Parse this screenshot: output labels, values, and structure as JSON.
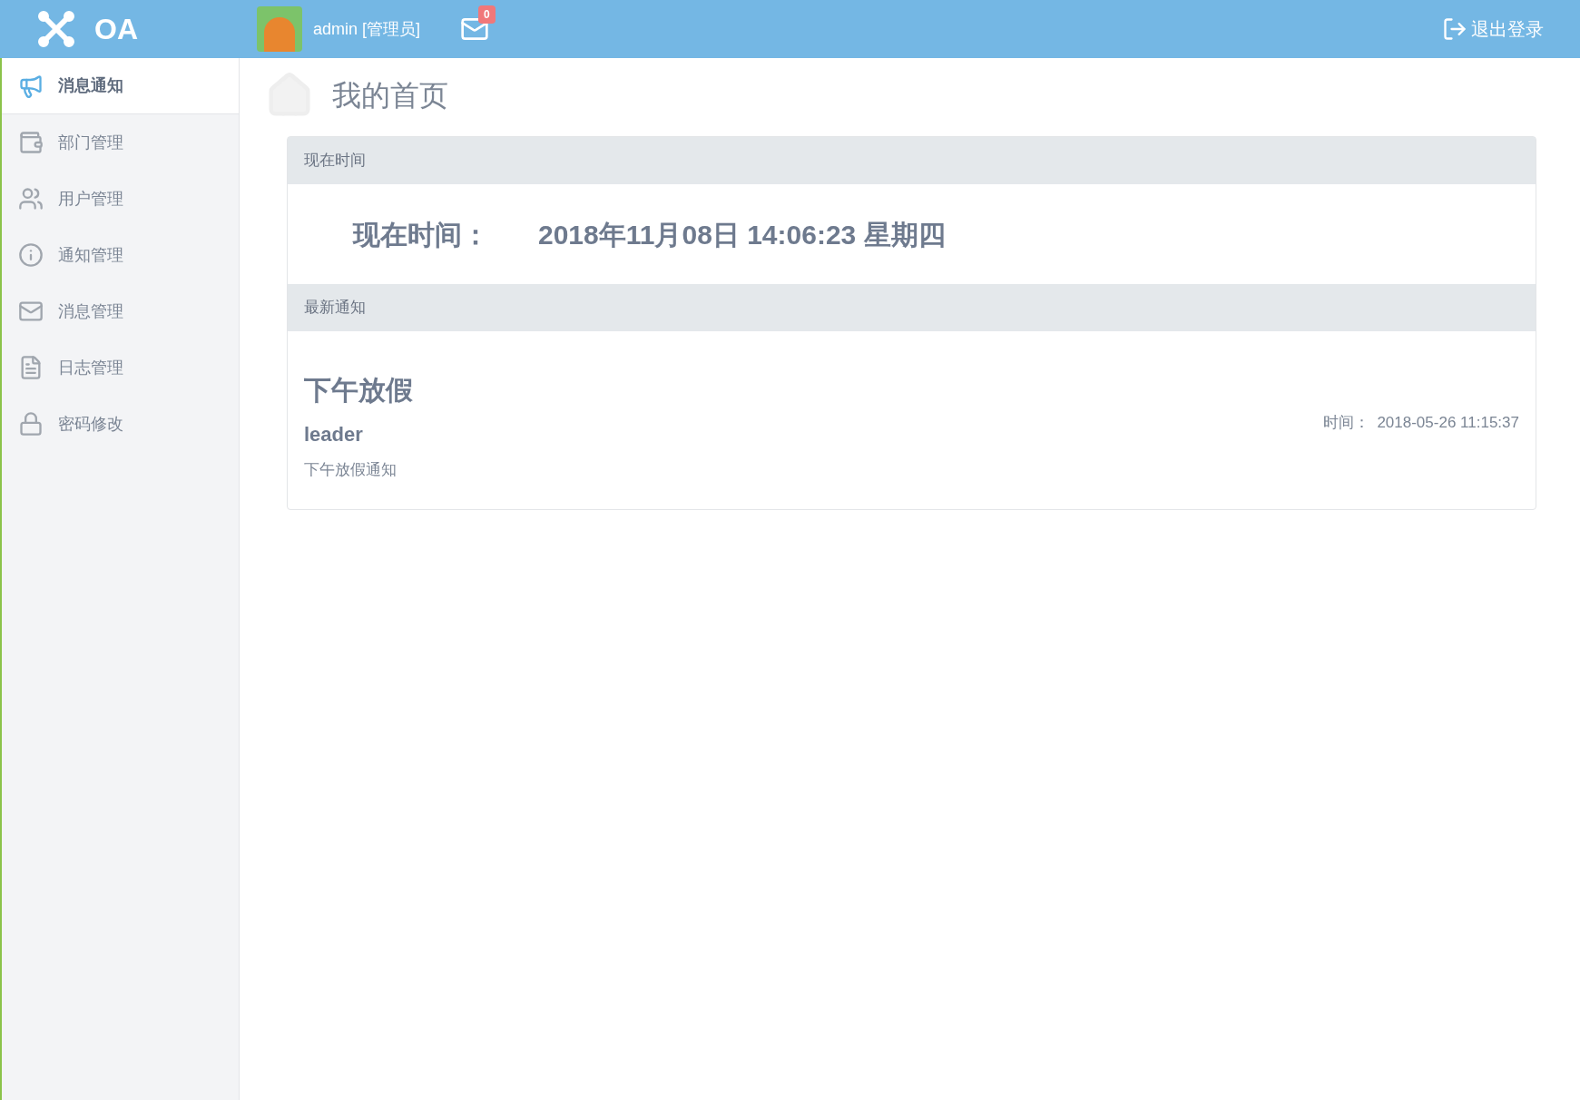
{
  "header": {
    "logo": "OA",
    "user": "admin [管理员]",
    "mail_badge": "0",
    "logout": "退出登录"
  },
  "sidebar": {
    "items": [
      {
        "label": "消息通知",
        "selected": true
      },
      {
        "label": "部门管理",
        "selected": false
      },
      {
        "label": "用户管理",
        "selected": false
      },
      {
        "label": "通知管理",
        "selected": false
      },
      {
        "label": "消息管理",
        "selected": false
      },
      {
        "label": "日志管理",
        "selected": false
      },
      {
        "label": "密码修改",
        "selected": false
      }
    ]
  },
  "page_title": "我的首页",
  "time_panel": {
    "heading": "现在时间",
    "label": "现在时间：",
    "value": "2018年11月08日 14:06:23 星期四"
  },
  "notice_panel": {
    "heading": "最新通知",
    "title": "下午放假",
    "author": "leader",
    "time_label": "时间：",
    "time": "2018-05-26 11:15:37",
    "body": "下午放假通知"
  }
}
